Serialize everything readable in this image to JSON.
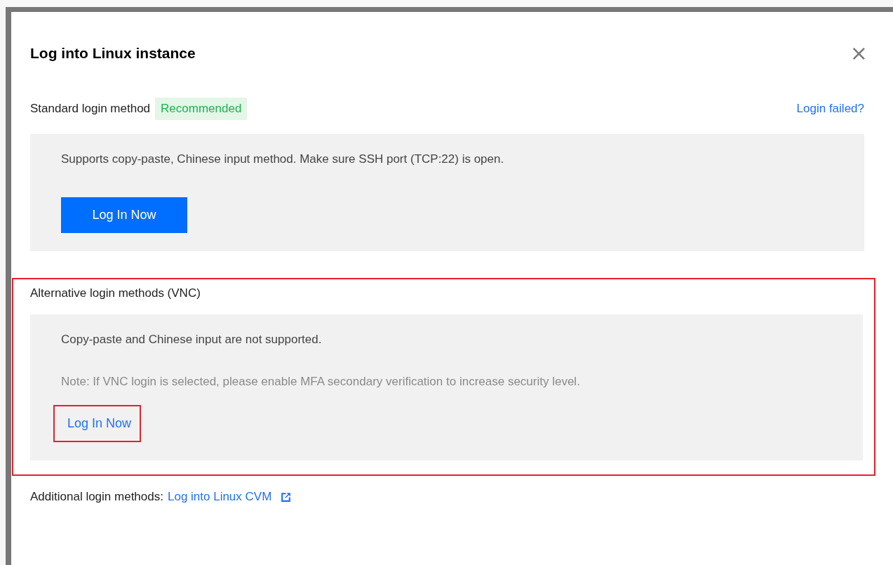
{
  "dialog": {
    "title": "Log into Linux instance",
    "close": "×"
  },
  "standard": {
    "label": "Standard login method",
    "badge": "Recommended",
    "help_link": "Login failed?",
    "description": "Supports copy-paste, Chinese input method. Make sure SSH port (TCP:22) is open.",
    "button": "Log In Now"
  },
  "alternative": {
    "label": "Alternative login methods (VNC)",
    "description": "Copy-paste and Chinese input are not supported.",
    "note": "Note: If VNC login is selected, please enable MFA secondary verification to increase security level.",
    "link": "Log In Now",
    "highlighted": true,
    "link_highlighted": true
  },
  "additional": {
    "label": "Additional login methods:",
    "link": "Log into Linux CVM"
  }
}
